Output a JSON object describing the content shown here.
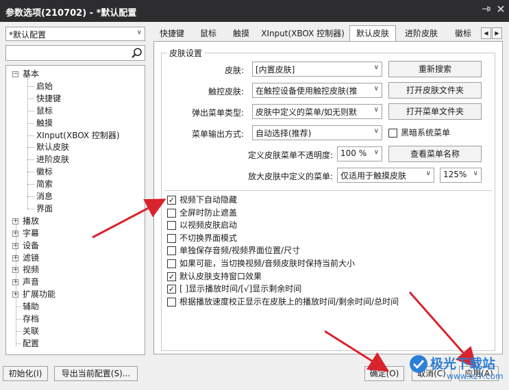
{
  "window": {
    "title": "参数选项(210702) - *默认配置",
    "pin_icon": "pin-icon",
    "close_icon": "close-icon"
  },
  "profile": {
    "selected": "*默认配置"
  },
  "tree": [
    {
      "label": "基本",
      "toggle": "⊟"
    },
    {
      "label": "启始"
    },
    {
      "label": "快捷键"
    },
    {
      "label": "鼠标"
    },
    {
      "label": "触摸"
    },
    {
      "label": "XInput(XBOX 控制器)"
    },
    {
      "label": "默认皮肤"
    },
    {
      "label": "进阶皮肤"
    },
    {
      "label": "徽标"
    },
    {
      "label": "简索"
    },
    {
      "label": "消息"
    },
    {
      "label": "界面"
    },
    {
      "label": "播放",
      "toggle": "⊞"
    },
    {
      "label": "字幕",
      "toggle": "⊞"
    },
    {
      "label": "设备",
      "toggle": "⊞"
    },
    {
      "label": "滤镜",
      "toggle": "⊞"
    },
    {
      "label": "视频",
      "toggle": "⊞"
    },
    {
      "label": "声音",
      "toggle": "⊞"
    },
    {
      "label": "扩展功能",
      "toggle": "⊞"
    },
    {
      "label": "辅助"
    },
    {
      "label": "存档"
    },
    {
      "label": "关联"
    },
    {
      "label": "配置"
    }
  ],
  "tabs": [
    "快捷键",
    "鼠标",
    "触摸",
    "XInput(XBOX 控制器)",
    "默认皮肤",
    "进阶皮肤",
    "徽标"
  ],
  "active_tab": "默认皮肤",
  "tab_scroll": {
    "left": "◀",
    "right": "▶"
  },
  "group": {
    "title": "皮肤设置",
    "rows": {
      "skin": {
        "label": "皮肤:",
        "value": "[内置皮肤]",
        "button": "重新搜索"
      },
      "touch_skin": {
        "label": "触控皮肤:",
        "value": "在触控设备使用触控皮肤(推",
        "button": "打开皮肤文件夹"
      },
      "popup_menu": {
        "label": "弹出菜单类型:",
        "value": "皮肤中定义的菜单/如无则默",
        "button": "打开菜单文件夹"
      },
      "menu_output": {
        "label": "菜单输出方式:",
        "value": "自动选择(推荐)",
        "checkbox": "黑暗系统菜单",
        "checked": false
      },
      "opacity": {
        "label": "定义皮肤菜单不透明度:",
        "value": "100 %",
        "button": "查看菜单名称"
      },
      "zoom_menu": {
        "label": "放大皮肤中定义的菜单:",
        "value": "仅适用于触摸皮肤",
        "value2": "125%"
      }
    },
    "checkboxes": [
      {
        "label": "视频下自动隐藏",
        "checked": true
      },
      {
        "label": "全屏时防止遮盖",
        "checked": false
      },
      {
        "label": "以视频皮肤启动",
        "checked": false
      },
      {
        "label": "不切换界面模式",
        "checked": false
      },
      {
        "label": "单独保存音频/视频界面位置/尺寸",
        "checked": false
      },
      {
        "label": "如果可能，当切换视频/音频皮肤时保持当前大小",
        "checked": false
      },
      {
        "label": "默认皮肤支持窗口效果",
        "checked": true
      },
      {
        "label": "[ ]显示播放时间/[√]显示剩余时间",
        "checked": true
      },
      {
        "label": "根据播放速度校正显示在皮肤上的播放时间/剩余时间/总时间",
        "checked": false
      }
    ]
  },
  "bottom": {
    "init": "初始化(I)",
    "export": "导出当前配置(S)...",
    "ok": "确定(O)",
    "cancel": "取消(C)",
    "apply": "应用(A)"
  },
  "watermark": {
    "name": "极光下载站",
    "url": "www.xz7.com"
  },
  "colors": {
    "titlebar": "#2d2d30",
    "arrow": "#d9232e",
    "watermark": "#2c7fd6"
  }
}
